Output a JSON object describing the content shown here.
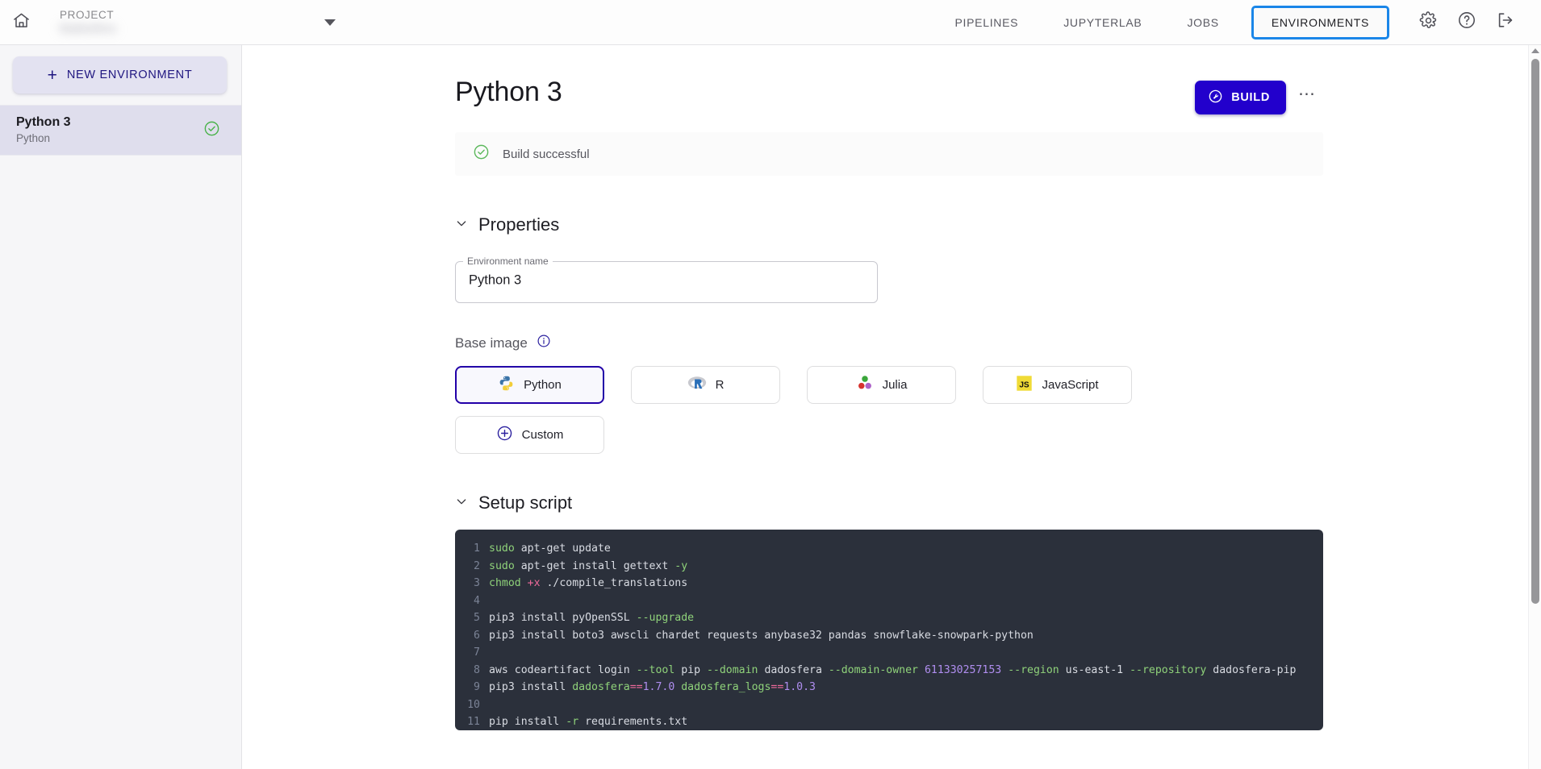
{
  "topbar": {
    "home_icon": "home-icon",
    "project_label": "PROJECT",
    "project_value": "Dadosfera",
    "caret_icon": "chevron-down-icon",
    "tabs": [
      {
        "label": "PIPELINES",
        "active": false
      },
      {
        "label": "JUPYTERLAB",
        "active": false
      },
      {
        "label": "JOBS",
        "active": false
      },
      {
        "label": "ENVIRONMENTS",
        "active": true
      }
    ],
    "icons": [
      {
        "name": "gear-icon",
        "title": "Settings"
      },
      {
        "name": "help-circle-icon",
        "title": "Help"
      },
      {
        "name": "logout-icon",
        "title": "Logout"
      }
    ]
  },
  "sidebar": {
    "new_environment_label": "NEW ENVIRONMENT",
    "new_environment_icon": "plus-icon",
    "items": [
      {
        "name": "Python 3",
        "subtitle": "Python",
        "status_icon": "check-circle-icon",
        "selected": true
      }
    ]
  },
  "main": {
    "page_title": "Python 3",
    "build_button": {
      "label": "BUILD",
      "icon": "build-wrench-icon"
    },
    "more_button": {
      "label": "⋯",
      "icon": "more-horizontal-icon"
    },
    "alert": {
      "icon": "check-circle-icon",
      "text": "Build successful"
    },
    "properties": {
      "section_title": "Properties",
      "collapse_icon": "chevron-down-icon",
      "environment_name": {
        "label": "Environment name",
        "value": "Python 3"
      }
    },
    "base_image": {
      "label": "Base image",
      "info_icon": "info-circle-icon",
      "options": [
        {
          "name": "Python",
          "icon": "python-logo-icon",
          "selected": true
        },
        {
          "name": "R",
          "icon": "r-logo-icon",
          "selected": false
        },
        {
          "name": "Julia",
          "icon": "julia-logo-icon",
          "selected": false
        },
        {
          "name": "JavaScript",
          "icon": "javascript-logo-icon",
          "selected": false
        },
        {
          "name": "Custom",
          "icon": "plus-circle-icon",
          "selected": false
        }
      ]
    },
    "setup_script": {
      "section_title": "Setup script",
      "collapse_icon": "chevron-down-icon",
      "lines": [
        {
          "n": "1",
          "tokens": [
            {
              "t": "sudo",
              "c": "grn"
            },
            {
              "t": " apt-get update",
              "c": "txt"
            }
          ]
        },
        {
          "n": "2",
          "tokens": [
            {
              "t": "sudo",
              "c": "grn"
            },
            {
              "t": " apt-get install gettext ",
              "c": "txt"
            },
            {
              "t": "-y",
              "c": "grn"
            }
          ]
        },
        {
          "n": "3",
          "tokens": [
            {
              "t": "chmod",
              "c": "grn"
            },
            {
              "t": " ",
              "c": "txt"
            },
            {
              "t": "+x",
              "c": "pnk"
            },
            {
              "t": " ./compile_translations",
              "c": "txt"
            }
          ]
        },
        {
          "n": "4",
          "tokens": []
        },
        {
          "n": "5",
          "tokens": [
            {
              "t": "pip3 install pyOpenSSL ",
              "c": "txt"
            },
            {
              "t": "--upgrade",
              "c": "grn"
            }
          ]
        },
        {
          "n": "6",
          "tokens": [
            {
              "t": "pip3 install boto3 awscli chardet requests anybase32 pandas snowflake-snowpark-python",
              "c": "txt"
            }
          ]
        },
        {
          "n": "7",
          "tokens": []
        },
        {
          "n": "8",
          "tokens": [
            {
              "t": "aws codeartifact login ",
              "c": "txt"
            },
            {
              "t": "--tool",
              "c": "grn"
            },
            {
              "t": " pip ",
              "c": "txt"
            },
            {
              "t": "--domain",
              "c": "grn"
            },
            {
              "t": " dadosfera ",
              "c": "txt"
            },
            {
              "t": "--domain-owner",
              "c": "grn"
            },
            {
              "t": " ",
              "c": "txt"
            },
            {
              "t": "611330257153",
              "c": "pur"
            },
            {
              "t": " ",
              "c": "txt"
            },
            {
              "t": "--region",
              "c": "grn"
            },
            {
              "t": " us-east-1 ",
              "c": "txt"
            },
            {
              "t": "--repository",
              "c": "grn"
            },
            {
              "t": " dadosfera-pip",
              "c": "txt"
            }
          ]
        },
        {
          "n": "9",
          "tokens": [
            {
              "t": "pip3 install ",
              "c": "txt"
            },
            {
              "t": "dadosfera",
              "c": "grn"
            },
            {
              "t": "==",
              "c": "pnk"
            },
            {
              "t": "1.7.0",
              "c": "pur"
            },
            {
              "t": " ",
              "c": "txt"
            },
            {
              "t": "dadosfera_logs",
              "c": "grn"
            },
            {
              "t": "==",
              "c": "pnk"
            },
            {
              "t": "1.0.3",
              "c": "pur"
            }
          ]
        },
        {
          "n": "10",
          "tokens": []
        },
        {
          "n": "11",
          "tokens": [
            {
              "t": "pip install ",
              "c": "txt"
            },
            {
              "t": "-r",
              "c": "grn"
            },
            {
              "t": " requirements.txt",
              "c": "txt"
            }
          ]
        }
      ]
    }
  },
  "scrollbar": {
    "up_arrow_icon": "caret-up-icon",
    "thumb": "scroll-thumb"
  },
  "colors": {
    "brand_indigo": "#2200cc",
    "focus_blue": "#1a86e8",
    "success_green": "#4caf50",
    "sidebar_selected": "#dfdeed",
    "code_bg": "#2b303b"
  }
}
